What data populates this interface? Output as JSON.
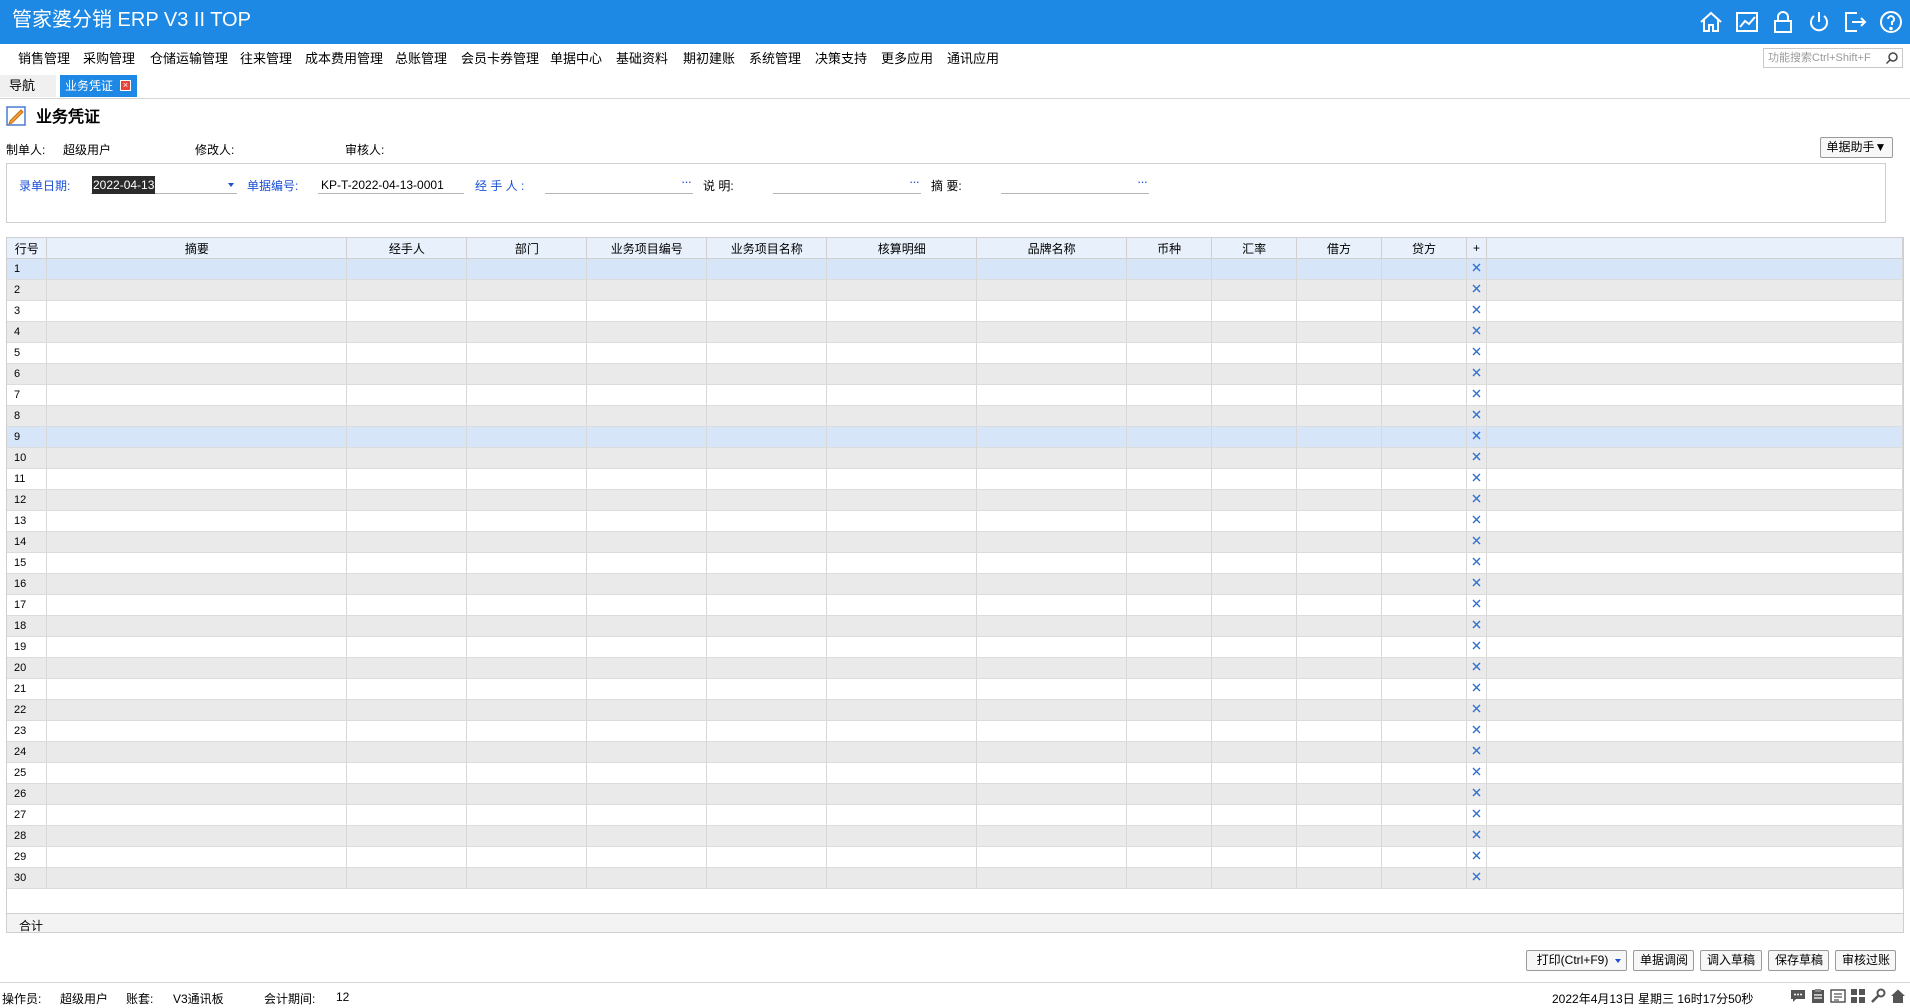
{
  "app": {
    "title": "管家婆分销 ERP V3 II TOP"
  },
  "title_icons": [
    "home-icon",
    "chart-icon",
    "lock-icon",
    "power-icon",
    "logout-icon",
    "help-icon"
  ],
  "menu": [
    "销售管理",
    "采购管理",
    "仓储运输管理",
    "往来管理",
    "成本费用管理",
    "总账管理",
    "会员卡券管理",
    "单据中心",
    "基础资料",
    "期初建账",
    "系统管理",
    "决策支持",
    "更多应用",
    "通讯应用"
  ],
  "search": {
    "placeholder": "功能搜索Ctrl+Shift+F"
  },
  "tabs": {
    "nav": "导航",
    "active": "业务凭证"
  },
  "page": {
    "title": "业务凭证"
  },
  "meta": {
    "creator_label": "制单人:",
    "creator": "超级用户",
    "modifier_label": "修改人:",
    "auditor_label": "审核人:"
  },
  "helper_button": "单据助手▼",
  "form": {
    "date_label": "录单日期:",
    "date_value": "2022-04-13",
    "number_label": "单据编号:",
    "number_value": "KP-T-2022-04-13-0001",
    "handler_label": "经 手 人 :",
    "desc_label": "说      明:",
    "summary_label": "摘      要:",
    "ellipsis": "···"
  },
  "grid": {
    "columns": [
      "行号",
      "摘要",
      "经手人",
      "部门",
      "业务项目编号",
      "业务项目名称",
      "核算明细",
      "品牌名称",
      "币种",
      "汇率",
      "借方",
      "贷方",
      "+"
    ],
    "rows": [
      "1",
      "2",
      "3",
      "4",
      "5",
      "6",
      "7",
      "8",
      "9",
      "10",
      "11",
      "12",
      "13",
      "14",
      "15",
      "16",
      "17",
      "18",
      "19",
      "20",
      "21",
      "22",
      "23",
      "24",
      "25",
      "26",
      "27",
      "28",
      "29",
      "30"
    ],
    "selected_rows": [
      "1",
      "9"
    ],
    "total_label": "合计"
  },
  "actions": [
    "打印(Ctrl+F9)",
    "单据调阅",
    "调入草稿",
    "保存草稿",
    "审核过账"
  ],
  "status": {
    "operator_label": "操作员:",
    "operator": "超级用户",
    "account_label": "账套:",
    "account": "V3通讯板",
    "period_label": "会计期间:",
    "period": "12",
    "datetime": "2022年4月13日  星期三  16时17分50秒"
  },
  "colors": {
    "brand": "#1e88e5",
    "label_blue": "#1a4fd6",
    "row_alt": "#eaeaea",
    "row_selected": "#d6e6f8"
  }
}
